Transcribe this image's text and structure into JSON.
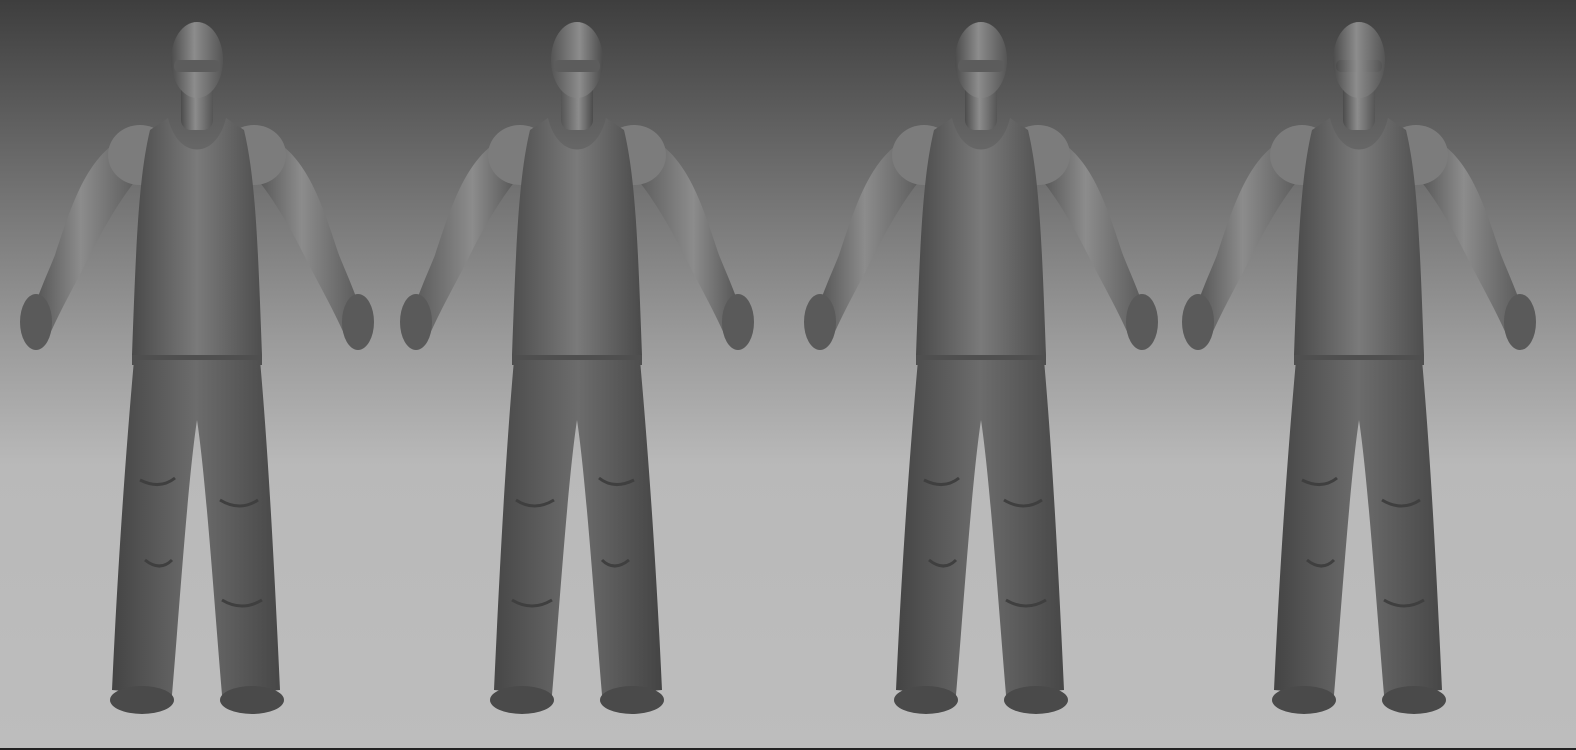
{
  "scene": {
    "views": [
      {
        "id": "front",
        "facing": "front"
      },
      {
        "id": "three-quarter-right",
        "facing": "three-quarter"
      },
      {
        "id": "three-quarter-left",
        "facing": "three-quarter"
      },
      {
        "id": "back",
        "facing": "back"
      }
    ]
  },
  "colors": {
    "clay_dark": "#4a4a4a",
    "clay_mid": "#6e6e6e",
    "clay_light": "#9a9a9a",
    "background_top": "#3e3e3e",
    "background_bottom": "#bdbdbd"
  }
}
